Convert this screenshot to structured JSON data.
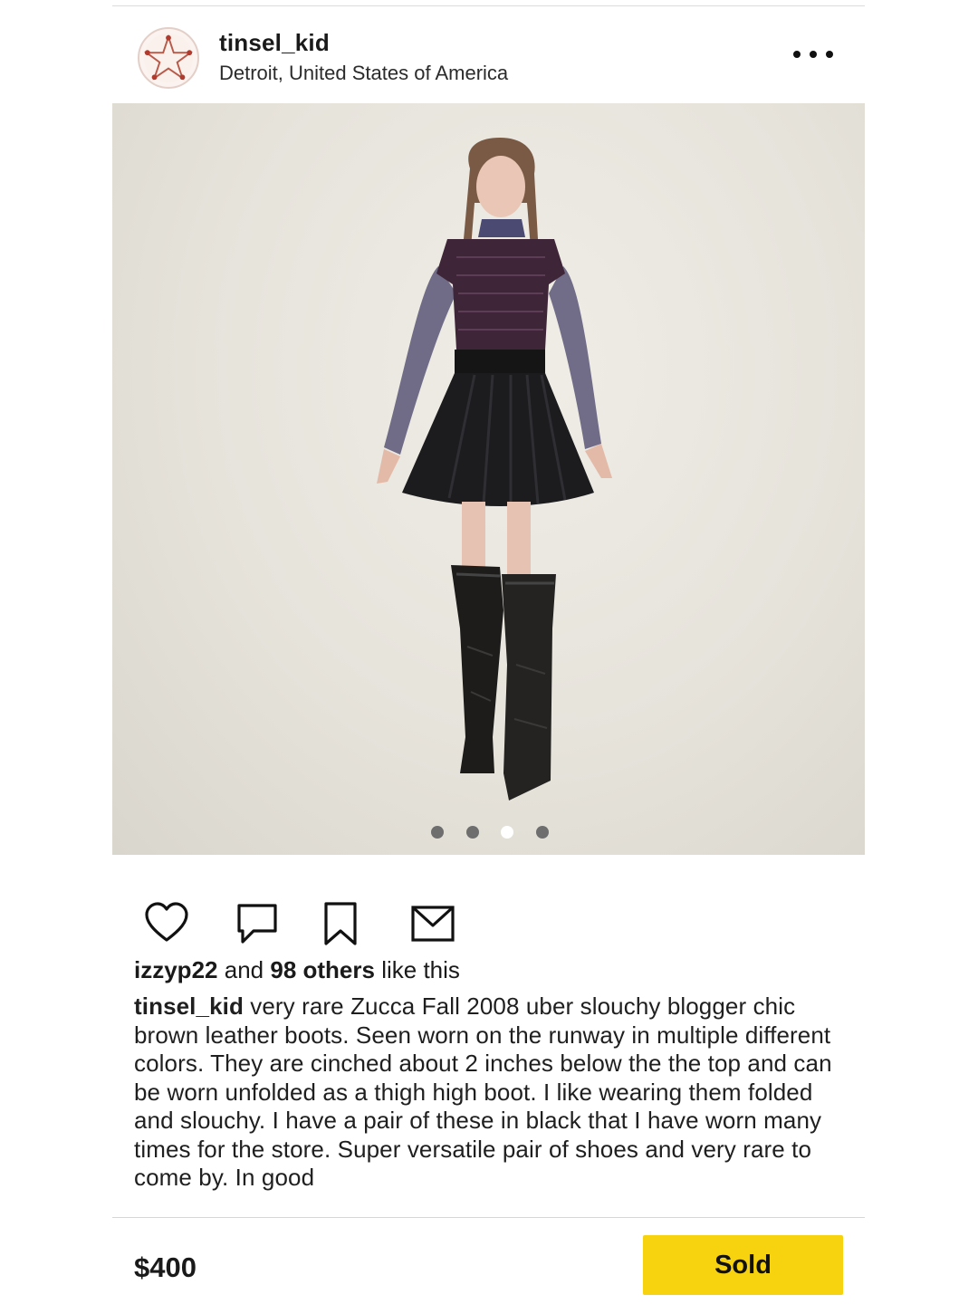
{
  "post": {
    "username": "tinsel_kid",
    "location": "Detroit, United States of America"
  },
  "carousel": {
    "count": 4,
    "active_index": 2
  },
  "icons": {
    "like": "heart-icon",
    "comment": "comment-icon",
    "save": "bookmark-icon",
    "share": "envelope-icon",
    "menu": "more-dots-icon"
  },
  "likes": {
    "user": "izzyp22",
    "and": "and",
    "others": "98 others",
    "suffix": "like this"
  },
  "caption": {
    "user": "tinsel_kid",
    "text": "very rare Zucca Fall 2008 uber slouchy blogger chic brown leather boots. Seen worn on the runway in multiple different colors. They are cinched about 2 inches below the the top and can be worn unfolded as a thigh high boot. I like wearing them folded and slouchy. I have a pair of these in black that I have worn many times for the store. Super versatile pair of shoes and very rare to come by. In good"
  },
  "listing": {
    "price": "$400",
    "status_button": "Sold"
  },
  "colors": {
    "sold_button": "#f7d20e",
    "active_dot": "#ffffff",
    "inactive_dot": "#6e6e6e"
  }
}
